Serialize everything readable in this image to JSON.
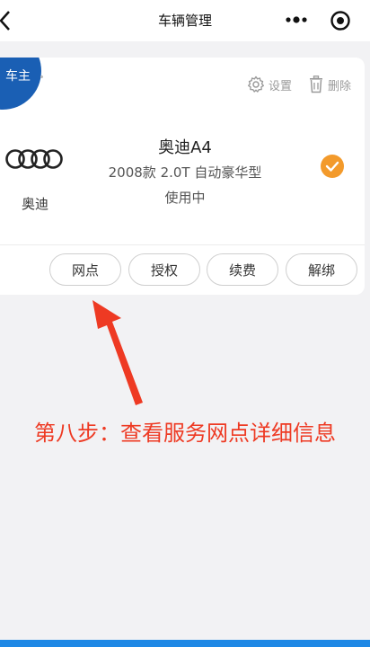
{
  "header": {
    "title": "车辆管理",
    "back_icon": "chevron-left-icon",
    "more_icon": "more-dots-icon",
    "target_icon": "target-circle-icon"
  },
  "card": {
    "badge_label": "车主",
    "settings_label": "设置",
    "delete_label": "删除",
    "brand_name": "奥迪",
    "model": "奥迪A4",
    "spec": "2008款 2.0T 自动豪华型",
    "status": "使用中",
    "buttons": [
      "网点",
      "授权",
      "续费",
      "解绑"
    ]
  },
  "annotation": {
    "text": "第八步：查看服务网点详细信息"
  },
  "colors": {
    "badge": "#1a5fb4",
    "check": "#f39a2b",
    "annotation": "#ee3a23",
    "bottom_bar": "#1e88e5"
  }
}
